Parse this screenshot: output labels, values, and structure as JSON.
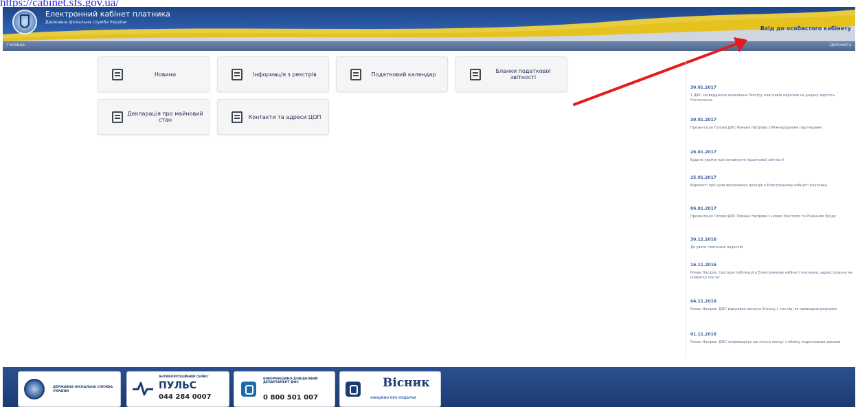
{
  "url": "https://cabinet.sfs.gov.ua/",
  "header": {
    "title": "Електронний кабінет платника",
    "subtitle": "Державна фіскальна служба України",
    "login_link": "Вхід до особистого кабінету"
  },
  "subbar": {
    "left": "Головна",
    "right": "Допомога"
  },
  "tiles": [
    {
      "label": "Новини"
    },
    {
      "label": "Інформація з реєстрів"
    },
    {
      "label": "Податковий календар"
    },
    {
      "label": "Бланки податкової звітності"
    },
    {
      "label": "Декларація про майновий стан"
    },
    {
      "label": "Контакти та адреси ЦОП"
    }
  ],
  "news": [
    {
      "date": "30.01.2017",
      "text": "1 ДФС затверджено оновлення Реєстру платників податків на додану вартість. Роз'яснення"
    },
    {
      "date": "30.01.2017",
      "text": "Презентація Голови ДФС Романа Насірова з Міжнародними партнерами"
    },
    {
      "date": "26.01.2017",
      "text": "Будьте уважні при заповненні податкової звітності"
    },
    {
      "date": "25.01.2017",
      "text": "Відомості про суми виплачених доходів в Електронному кабінеті платника"
    },
    {
      "date": "06.01.2017",
      "text": "Презентація Голови ДФС Романа Насірова з новим Реєстром та Рішенням Уряду"
    },
    {
      "date": "30.12.2016",
      "text": "До уваги платників податків"
    },
    {
      "date": "16.11.2016",
      "text": "Роман Насіров: Сьогодні публікації в Електронному кабінеті платника, зареєстровано на розвитку послуг"
    },
    {
      "date": "04.11.2016",
      "text": "Роман Насіров: ДФС відкриває послуги бізнесу з тих пір, як проведено реформи"
    },
    {
      "date": "01.11.2016",
      "text": "Роман Насіров: ДФС запроваджує ще кілька послуг з обміну податковими даними"
    }
  ],
  "footer": {
    "dfs": "ДЕРЖАВНА ФІСКАЛЬНА СЛУЖБА УКРАЇНИ",
    "puls_caption": "АНТИКОРУПЦІЙНИЙ СЕРВІС",
    "puls_name": "ПУЛЬС",
    "puls_phone": "044 284 0007",
    "info_caption": "ІНФОРМАЦІЙНО-ДОВІДКОВИЙ ДЕПАРТАМЕНТ ДФС",
    "info_phone": "0 800 501 007",
    "visnyk": "Вісник",
    "visnyk_caption": "ОФІЦІЙНО ПРО ПОДАТКИ"
  }
}
